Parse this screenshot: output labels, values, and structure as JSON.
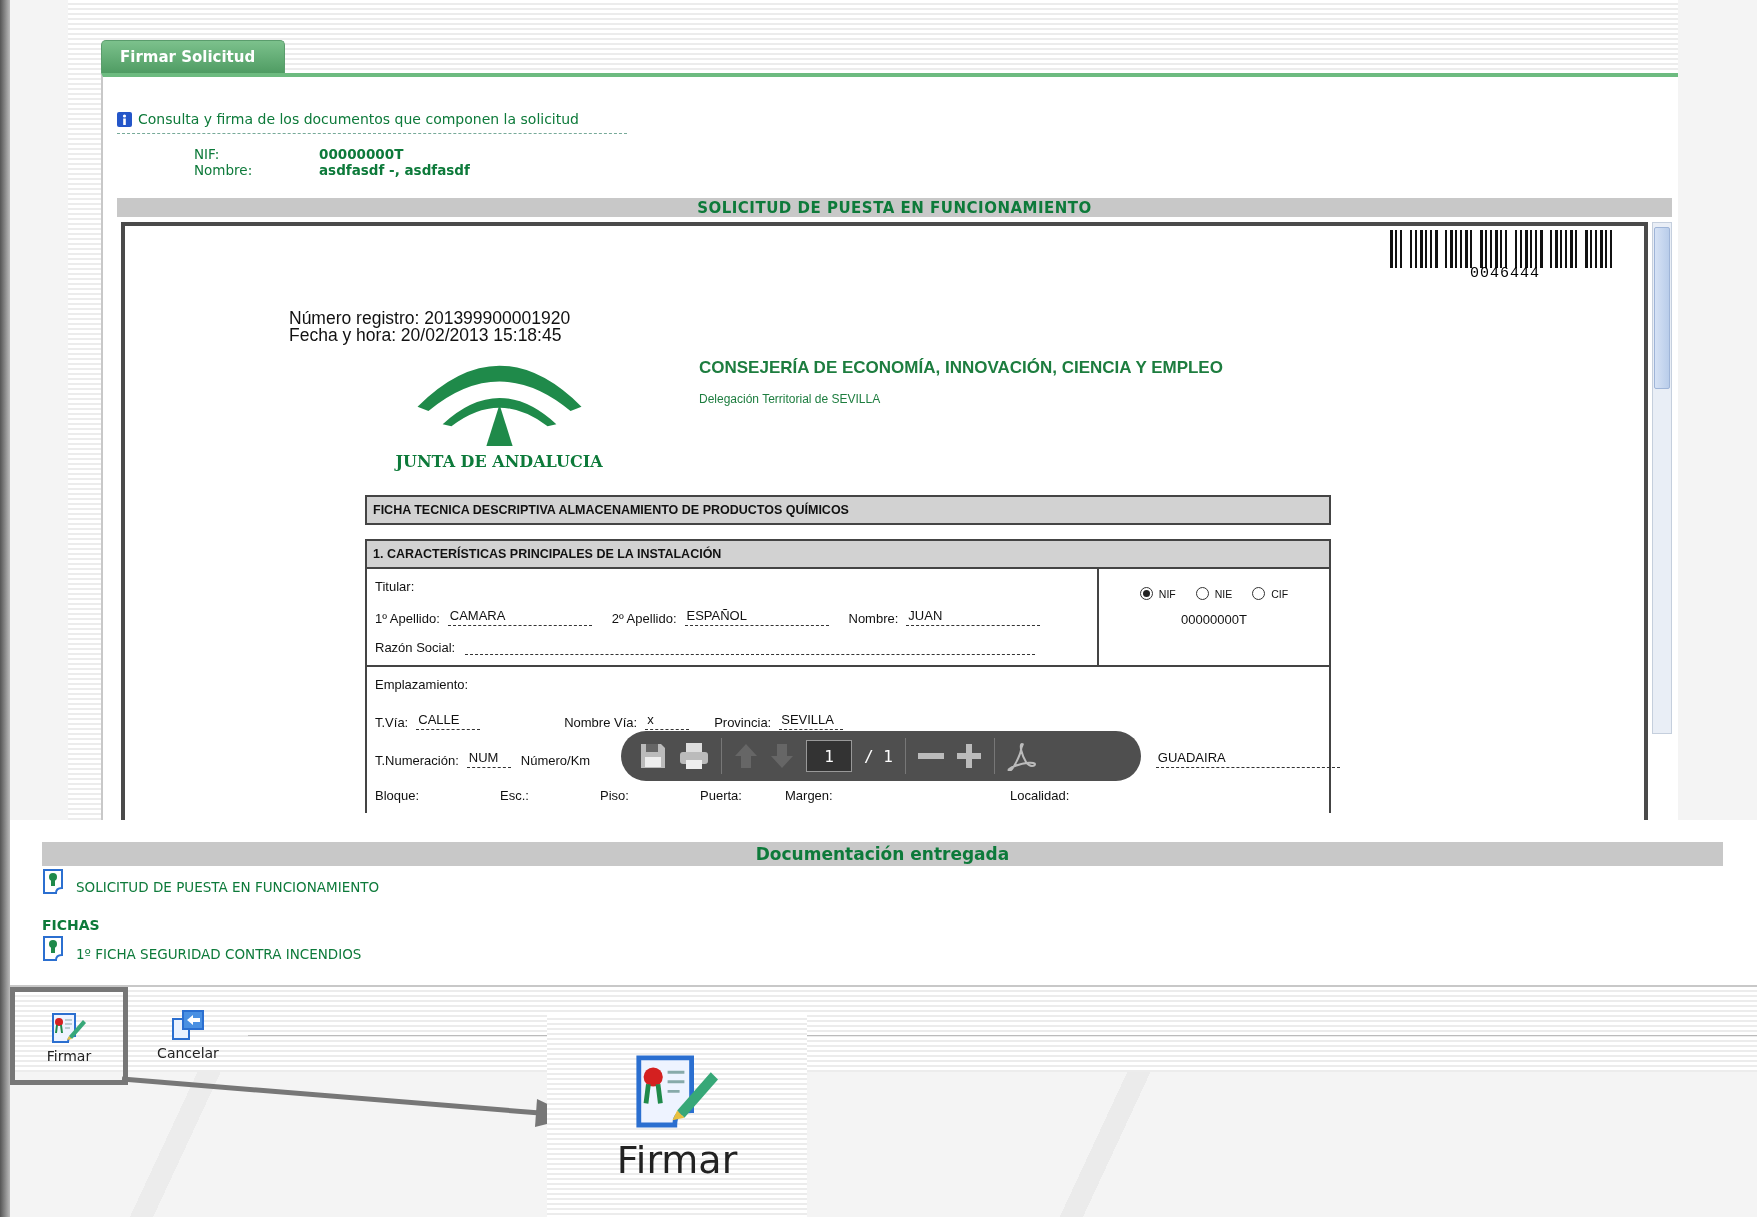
{
  "tab": {
    "label": "Firmar Solicitud",
    "selected": true
  },
  "info": "Consulta y firma de los documentos que componen la solicitud",
  "applicant": [
    {
      "label": "NIF:",
      "value": "00000000T"
    },
    {
      "label": "Nombre:",
      "value": "asdfasdf -, asdfasdf"
    }
  ],
  "viewer": {
    "title": "SOLICITUD DE PUESTA EN FUNCIONAMIENTO",
    "barcode_number": "0046444",
    "registry": [
      "Número registro: 201399900001920",
      "Fecha y hora: 20/02/2013 15:18:45"
    ],
    "logo_text": "JUNTA DE ANDALUCIA",
    "department": "CONSEJERÍA DE ECONOMÍA, INNOVACIÓN, CIENCIA Y EMPLEO",
    "delegation": "Delegación Territorial de SEVILLA",
    "form_title": "FICHA TECNICA DESCRIPTIVA ALMACENAMIENTO DE PRODUCTOS QUÍMICOS",
    "section_title": "1. CARACTERÍSTICAS PRINCIPALES DE LA INSTALACIÓN",
    "titular_label": "Titular:",
    "titular_fields": [
      {
        "label": "1º Apellido:",
        "value": "CAMARA"
      },
      {
        "label": "2º Apellido:",
        "value": "ESPAÑOL"
      },
      {
        "label": "Nombre:",
        "value": "JUAN"
      }
    ],
    "razon_label": "Razón Social:",
    "id_types": [
      {
        "label": "NIF",
        "selected": true
      },
      {
        "label": "NIE",
        "selected": false
      },
      {
        "label": "CIF",
        "selected": false
      }
    ],
    "id_value": "00000000T",
    "location_label": "Emplazamiento:",
    "location_rows": [
      [
        {
          "label": "T.Vía:",
          "value": "CALLE"
        },
        {
          "label": "Nombre Vía:",
          "value": "x"
        },
        {
          "label": "Provincia:",
          "value": "SEVILLA"
        }
      ],
      [
        {
          "label": "T.Numeración:",
          "value": "NUM"
        },
        {
          "label": "Número/Km"
        },
        {
          "value": "GUADAIRA"
        }
      ],
      [
        {
          "label": "Bloque:"
        },
        {
          "label": "Esc.:"
        },
        {
          "label": "Piso:"
        },
        {
          "label": "Puerta:"
        },
        {
          "label": "Margen:"
        },
        {
          "label": "Localidad:"
        }
      ]
    ],
    "pdf_toolbar": {
      "page": "1",
      "separator": "/",
      "total": "1"
    }
  },
  "documents": {
    "title": "Documentación entregada",
    "items": [
      {
        "kind": "document",
        "label": "SOLICITUD DE PUESTA EN FUNCIONAMIENTO"
      },
      {
        "kind": "heading",
        "label": "FICHAS"
      },
      {
        "kind": "document",
        "label": "1º FICHA SEGURIDAD CONTRA INCENDIOS"
      }
    ]
  },
  "actions": [
    {
      "kind": "sign",
      "label": "Firmar",
      "highlighted": true
    },
    {
      "kind": "cancel",
      "label": "Cancelar",
      "highlighted": false
    }
  ],
  "callout": {
    "label": "Firmar"
  }
}
